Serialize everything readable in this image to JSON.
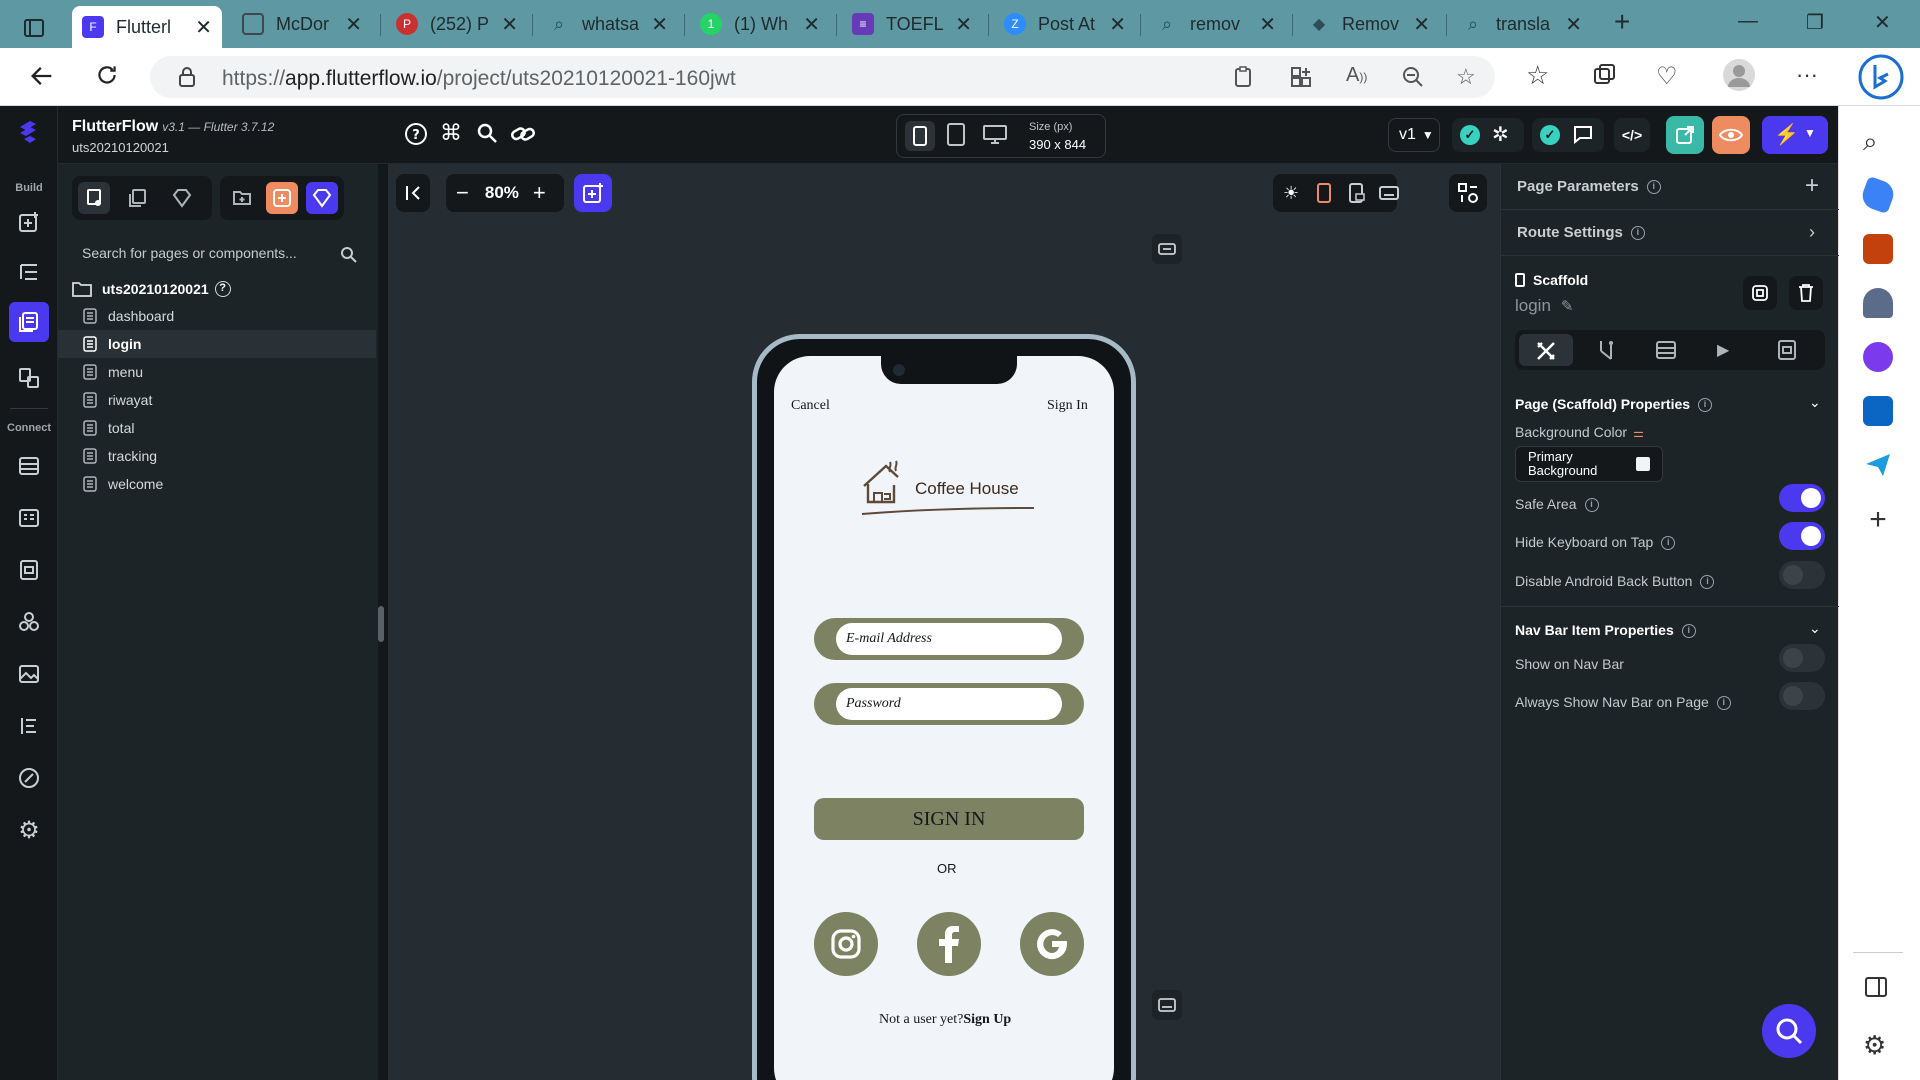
{
  "browser": {
    "tabs": [
      {
        "title": "Flutterl",
        "favicon_color": "#4b39ef",
        "active": true
      },
      {
        "title": "McDor",
        "favicon_color": "#6b7a7e",
        "active": false
      },
      {
        "title": "(252) P",
        "favicon_color": "#e60023",
        "active": false
      },
      {
        "title": "whatsa",
        "favicon_color": "#5e99a3",
        "active": false
      },
      {
        "title": "(1) Wh",
        "favicon_color": "#25d366",
        "active": false
      },
      {
        "title": "TOEFL",
        "favicon_color": "#673ab7",
        "active": false
      },
      {
        "title": "Post At",
        "favicon_color": "#2d8cff",
        "active": false
      },
      {
        "title": "remov",
        "favicon_color": "#5e99a3",
        "active": false
      },
      {
        "title": "Remov",
        "favicon_color": "#6b7a7e",
        "active": false
      },
      {
        "title": "transla",
        "favicon_color": "#5e99a3",
        "active": false
      }
    ],
    "url_prefix": "https://",
    "url_host": "app.flutterflow.io",
    "url_path": "/project/uts20210120021-160jwt"
  },
  "app": {
    "name": "FlutterFlow",
    "version": "v3.1 — Flutter 3.7.12",
    "project_id": "uts20210120021",
    "rail": {
      "build_label": "Build",
      "connect_label": "Connect"
    },
    "accent": "#4b39ef"
  },
  "left_panel": {
    "search_placeholder": "Search for pages or components...",
    "root": "uts20210120021",
    "pages": [
      "dashboard",
      "login",
      "menu",
      "riwayat",
      "total",
      "tracking",
      "welcome"
    ],
    "selected_page": "login"
  },
  "canvas": {
    "zoom": "80%",
    "size_label": "Size (px)",
    "size_value": "390 x 844",
    "version": "v1"
  },
  "phone": {
    "cancel": "Cancel",
    "sign_in_top": "Sign In",
    "logo_text": "Coffee House",
    "email_placeholder": "E-mail Address",
    "password_placeholder": "Password",
    "sign_in_button": "SIGN IN",
    "or": "OR",
    "footer_prefix": "Not a user yet?",
    "footer_link": "Sign Up",
    "brand_color": "#7c8262"
  },
  "properties": {
    "page_parameters": "Page Parameters",
    "route_settings": "Route Settings",
    "widget_type": "Scaffold",
    "widget_name": "login",
    "scaffold_section": "Page (Scaffold) Properties",
    "background_color_label": "Background Color",
    "background_value": "Primary Background",
    "toggles": [
      {
        "label": "Safe Area",
        "on": true
      },
      {
        "label": "Hide Keyboard on Tap",
        "on": true
      },
      {
        "label": "Disable Android Back Button",
        "on": false
      }
    ],
    "navbar_section": "Nav Bar Item Properties",
    "navbar_toggles": [
      {
        "label": "Show on Nav Bar",
        "on": false
      },
      {
        "label": "Always Show Nav Bar on Page",
        "on": false
      }
    ]
  }
}
